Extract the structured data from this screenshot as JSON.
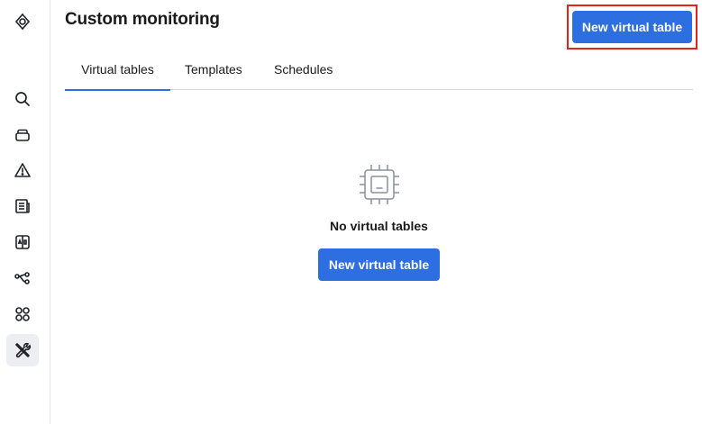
{
  "sidebar": {
    "items": [
      {
        "icon": "logo-icon"
      },
      {
        "icon": "search-icon"
      },
      {
        "icon": "database-icon"
      },
      {
        "icon": "alert-icon"
      },
      {
        "icon": "document-icon"
      },
      {
        "icon": "compare-icon"
      },
      {
        "icon": "lineage-icon"
      },
      {
        "icon": "apps-icon"
      },
      {
        "icon": "tools-icon",
        "active": true
      }
    ]
  },
  "header": {
    "title": "Custom monitoring",
    "primary_action": "New virtual table"
  },
  "tabs": [
    {
      "label": "Virtual tables",
      "active": true
    },
    {
      "label": "Templates",
      "active": false
    },
    {
      "label": "Schedules",
      "active": false
    }
  ],
  "empty_state": {
    "icon": "chip-icon",
    "title": "No virtual tables",
    "action_label": "New virtual table"
  },
  "colors": {
    "accent": "#2d6ee0",
    "highlight": "#e0261b",
    "icon_gray": "#1f2328"
  }
}
